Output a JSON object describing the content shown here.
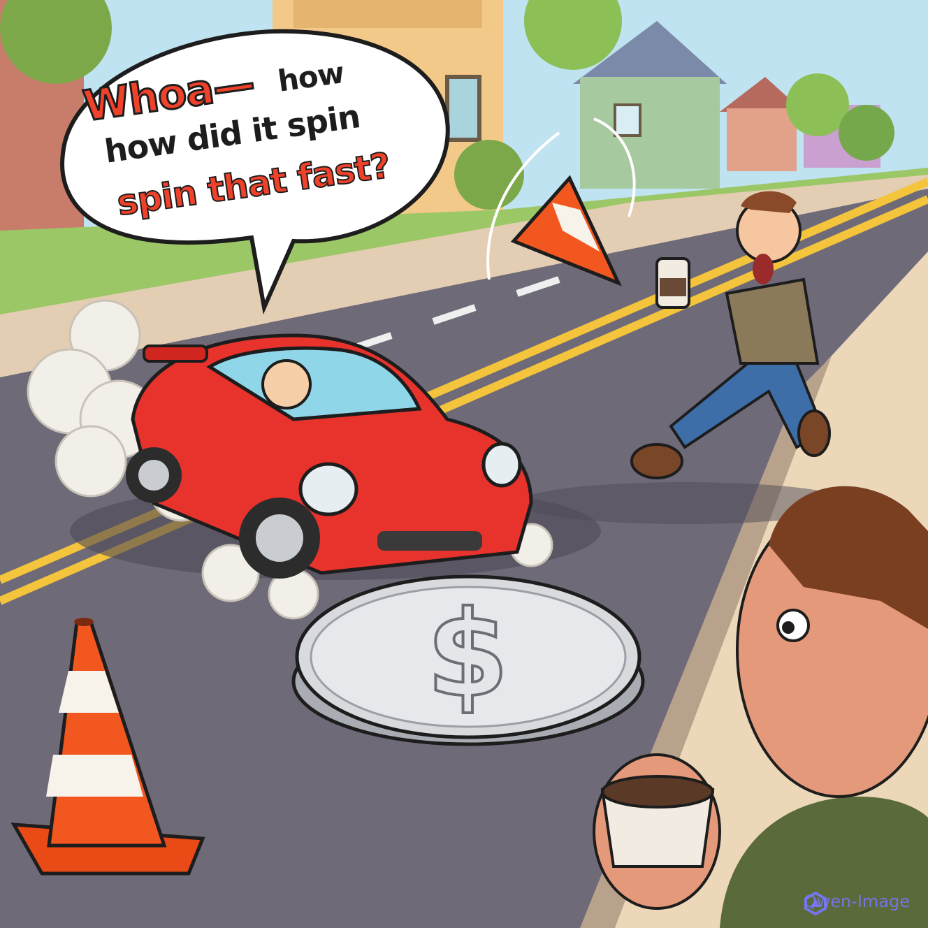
{
  "speech_bubble": {
    "line1_red": "Whoa—",
    "line1_black": "how",
    "line2": "how did it spin",
    "line3": "spin that fast?"
  },
  "watermark": {
    "text": "Qwen-Image",
    "icon": "qwen-logo-icon"
  },
  "colors": {
    "sky": "#bfe3f0",
    "road": "#6f6a78",
    "car": "#e8322c",
    "cone": "#f2571f",
    "coin": "#d8dade",
    "accent_text": "#f0412b"
  }
}
